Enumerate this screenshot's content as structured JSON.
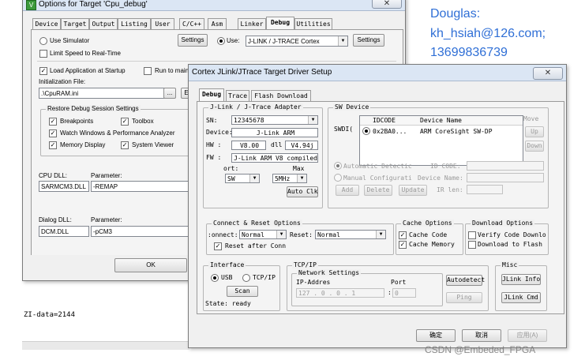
{
  "annotation": {
    "name": "Douglas:",
    "email": "kh_hsiah@126.com;",
    "phone": "13699836739",
    "color": "#2f6fd6"
  },
  "watermark": "CSDN @Embeded_FPGA",
  "background": {
    "zi_data": "ZI-data=2144"
  },
  "outer": {
    "title": "Options for Target 'Cpu_debug'",
    "close": "✕",
    "tabs": [
      "Device",
      "Target",
      "Output",
      "Listing",
      "User",
      "C/C++",
      "Asm",
      "Linker",
      "Debug",
      "Utilities"
    ],
    "active_tab": "Debug",
    "use_simulator": "Use Simulator",
    "limit_speed": "Limit Speed to Real-Time",
    "settings_left": "Settings",
    "use_label": "Use:",
    "debugger": "J-LINK / J-TRACE Cortex",
    "settings_right": "Settings",
    "load_app": "Load Application at Startup",
    "run_to_main": "Run to main",
    "init_file_label": "Initialization File:",
    "init_file": ".\\CpuRAM.ini",
    "browse": "...",
    "edit": "E",
    "restore_group": "Restore Debug Session Settings",
    "breakpoints": "Breakpoints",
    "toolbox": "Toolbox",
    "watch_windows": "Watch Windows & Performance Analyzer",
    "memory_display": "Memory Display",
    "system_viewer": "System Viewer",
    "cpu_dll_label": "CPU DLL:",
    "cpu_param_label": "Parameter:",
    "cpu_dll": "SARMCM3.DLL",
    "cpu_param": "-REMAP",
    "dialog_dll_label": "Dialog DLL:",
    "dialog_param_label": "Parameter:",
    "dialog_dll": "DCM.DLL",
    "dialog_param": "-pCM3",
    "ok": "OK"
  },
  "inner": {
    "title": "Cortex JLink/JTrace Target Driver Setup",
    "close": "✕",
    "tabs": [
      "Debug",
      "Trace",
      "Flash Download"
    ],
    "active_tab": "Debug",
    "adapter_group": "J-Link / J-Trace Adapter",
    "sn_label": "SN:",
    "sn_value": "12345678",
    "device_label": "Device:",
    "device_value": "J-Link ARM",
    "hw_label": "HW :",
    "hw_value": "V8.00",
    "dll_label": "dll",
    "dll_value": "V4.94j",
    "fw_label": "FW :",
    "fw_value": "J-Link ARM V8 compiled I",
    "port_label": "ort:",
    "max_label": "Max",
    "port_value": "SW",
    "max_value": "5MHz",
    "auto_clk": "Auto Clk",
    "swdevice_group": "SW Device",
    "swdi_label": "SWDI(",
    "col_idcode": "IDCODE",
    "col_device": "Device Name",
    "row_idcode": "0x2BA0...",
    "row_device": "ARM CoreSight SW-DP",
    "move_label": "Move",
    "up": "Up",
    "down": "Down",
    "auto_detect": "Automatic Detectic",
    "id_code_label": "ID CODE:",
    "manual_config": "Manual Configurati",
    "device_name_label": "Device Name:",
    "add": "Add",
    "delete": "Delete",
    "update": "Update",
    "ir_len": "IR len:",
    "connect_group": "Connect & Reset Options",
    "connect_label": ":onnect:",
    "connect_value": "Normal",
    "reset_label": "Reset:",
    "reset_value": "Normal",
    "reset_after": "Reset after Conn",
    "cache_group": "Cache Options",
    "cache_code": "Cache Code",
    "cache_memory": "Cache Memory",
    "download_group": "Download Options",
    "verify_code": "Verify Code Downlo",
    "download_flash": "Download to Flash",
    "interface_group": "Interface",
    "usb": "USB",
    "tcpip": "TCP/IP",
    "scan": "Scan",
    "state": "State: ready",
    "tcpip_group": "TCP/IP",
    "network_settings": "Network Settings",
    "ip_label": "IP-Addres",
    "port_lbl": "Port",
    "ip_value": "127 . 0 . 0 . 1",
    "port_value2": "0",
    "autodetect": "Autodetect",
    "ping": "Ping",
    "misc_group": "Misc",
    "jlink_info": "JLink Info",
    "jlink_cmd": "JLink Cmd",
    "ok": "确定",
    "cancel": "取消",
    "apply": "应用(A)"
  }
}
